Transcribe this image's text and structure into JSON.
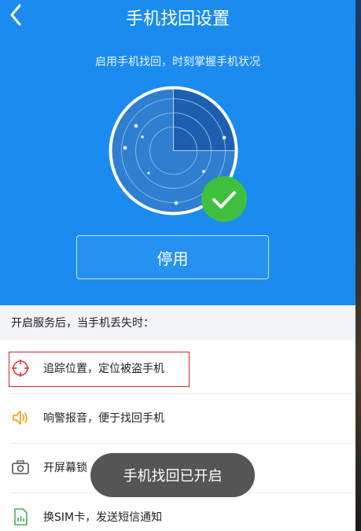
{
  "header": {
    "title": "手机找回设置",
    "back_icon": "back-arrow-icon"
  },
  "hero": {
    "subtitle": "启用手机找回，时刻掌握手机状况",
    "radar_icon": "radar-icon",
    "status_icon": "check-circle-icon",
    "stop_label": "停用",
    "accent_color": "#1a8cf0",
    "check_color": "#3ec03e"
  },
  "section": {
    "title": "开启服务后，当手机丢失时："
  },
  "features": [
    {
      "icon": "locate-icon",
      "label": "追踪位置，定位被盗手机",
      "color": "#e53935"
    },
    {
      "icon": "speaker-icon",
      "label": "响警报音，便于找回手机",
      "color": "#f5a623"
    },
    {
      "icon": "camera-icon",
      "label": "开屏幕锁",
      "color": "#555555"
    },
    {
      "icon": "sim-card-icon",
      "label": "换SIM卡，发送短信通知",
      "color": "#4caf50"
    }
  ],
  "toast": {
    "text": "手机找回已开启"
  }
}
